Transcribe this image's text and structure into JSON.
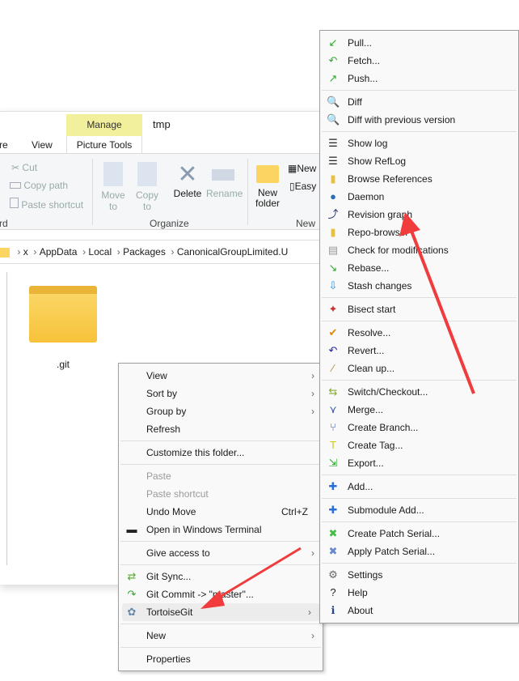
{
  "explorer": {
    "title": "tmp",
    "context_tab": "Manage",
    "context_group": "Picture Tools",
    "tabs": [
      "re",
      "View"
    ],
    "clipboard": {
      "cut": "Cut",
      "copy_path": "Copy path",
      "paste_shortcut": "Paste shortcut",
      "group": "rd"
    },
    "organize": {
      "move_to": "Move to",
      "copy_to": "Copy to",
      "delete": "Delete",
      "rename": "Rename",
      "group": "Organize"
    },
    "new": {
      "new_folder": "New folder",
      "new_item": "New",
      "easy_access": "Easy",
      "group": "New"
    },
    "breadcrumb": [
      "x",
      "AppData",
      "Local",
      "Packages",
      "CanonicalGroupLimited.U"
    ],
    "file": {
      "name": ".git"
    }
  },
  "context_menu": {
    "items": [
      {
        "label": "View",
        "submenu": true
      },
      {
        "label": "Sort by",
        "submenu": true
      },
      {
        "label": "Group by",
        "submenu": true
      },
      {
        "label": "Refresh"
      },
      {
        "label": "Customize this folder..."
      },
      {
        "label": "Paste",
        "disabled": true
      },
      {
        "label": "Paste shortcut",
        "disabled": true
      },
      {
        "label": "Undo Move",
        "shortcut": "Ctrl+Z"
      },
      {
        "label": "Open in Windows Terminal",
        "icon": "terminal-icon"
      },
      {
        "label": "Give access to",
        "submenu": true
      },
      {
        "label": "Git Sync...",
        "icon": "git-sync-icon"
      },
      {
        "label": "Git Commit -> \"master\"...",
        "icon": "git-commit-icon"
      },
      {
        "label": "TortoiseGit",
        "icon": "tortoisegit-icon",
        "submenu": true,
        "highlighted": true
      },
      {
        "label": "New",
        "submenu": true
      },
      {
        "label": "Properties"
      }
    ]
  },
  "tortoise_menu": {
    "items": [
      {
        "label": "Pull...",
        "icon": "pull-icon"
      },
      {
        "label": "Fetch...",
        "icon": "fetch-icon"
      },
      {
        "label": "Push...",
        "icon": "push-icon"
      },
      {
        "label": "Diff",
        "icon": "diff-icon"
      },
      {
        "label": "Diff with previous version",
        "icon": "diff-icon"
      },
      {
        "label": "Show log",
        "icon": "log-icon"
      },
      {
        "label": "Show RefLog",
        "icon": "reflog-icon"
      },
      {
        "label": "Browse References",
        "icon": "browse-references-icon"
      },
      {
        "label": "Daemon",
        "icon": "globe-icon"
      },
      {
        "label": "Revision graph",
        "icon": "revision-graph-icon"
      },
      {
        "label": "Repo-browser",
        "icon": "repo-browser-icon"
      },
      {
        "label": "Check for modifications",
        "icon": "check-modifications-icon"
      },
      {
        "label": "Rebase...",
        "icon": "rebase-icon"
      },
      {
        "label": "Stash changes",
        "icon": "stash-icon"
      },
      {
        "label": "Bisect start",
        "icon": "bisect-icon"
      },
      {
        "label": "Resolve...",
        "icon": "resolve-icon"
      },
      {
        "label": "Revert...",
        "icon": "revert-icon"
      },
      {
        "label": "Clean up...",
        "icon": "cleanup-icon"
      },
      {
        "label": "Switch/Checkout...",
        "icon": "switch-icon"
      },
      {
        "label": "Merge...",
        "icon": "merge-icon"
      },
      {
        "label": "Create Branch...",
        "icon": "branch-icon"
      },
      {
        "label": "Create Tag...",
        "icon": "tag-icon"
      },
      {
        "label": "Export...",
        "icon": "export-icon"
      },
      {
        "label": "Add...",
        "icon": "add-icon"
      },
      {
        "label": "Submodule Add...",
        "icon": "add-icon"
      },
      {
        "label": "Create Patch Serial...",
        "icon": "patch-icon"
      },
      {
        "label": "Apply Patch Serial...",
        "icon": "apply-patch-icon"
      },
      {
        "label": "Settings",
        "icon": "settings-icon"
      },
      {
        "label": "Help",
        "icon": "help-icon"
      },
      {
        "label": "About",
        "icon": "about-icon"
      }
    ]
  },
  "colors": {
    "manage_tab": "#f2f09c",
    "annotation_arrow": "#f03c3c"
  }
}
